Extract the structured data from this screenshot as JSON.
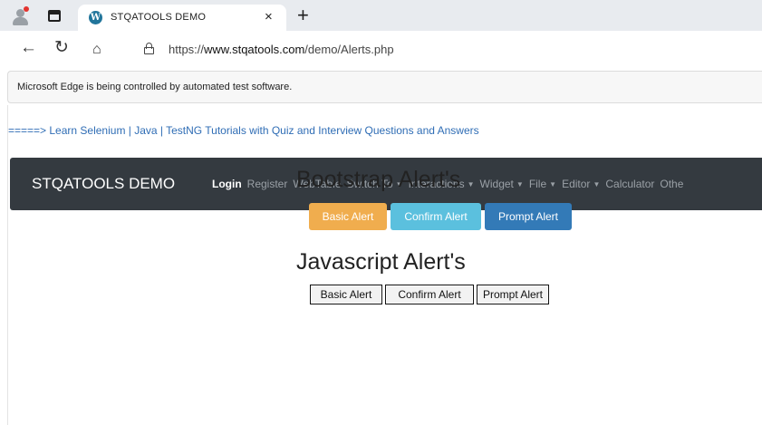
{
  "browser": {
    "tab_title": "STQATOOLS DEMO",
    "tab_close": "×",
    "new_tab": "+",
    "url_scheme": "https://",
    "url_host": "www.stqatools.com",
    "url_path": "/demo/Alerts.php",
    "infobar_text": "Microsoft Edge is being controlled by automated test software."
  },
  "page": {
    "promo_link": "=====> Learn Selenium | Java | TestNG Tutorials with Quiz and Interview Questions and Answers",
    "navbar": {
      "brand": "STQATOOLS DEMO",
      "items": [
        {
          "label": "Login",
          "active": true,
          "dropdown": false
        },
        {
          "label": "Register",
          "dropdown": false
        },
        {
          "label": "WebTable",
          "dropdown": false
        },
        {
          "label": "Switch To",
          "dropdown": true
        },
        {
          "label": "Interactions",
          "dropdown": true
        },
        {
          "label": "Widget",
          "dropdown": true
        },
        {
          "label": "File",
          "dropdown": true
        },
        {
          "label": "Editor",
          "dropdown": true
        },
        {
          "label": "Calculator",
          "dropdown": false
        },
        {
          "label": "Othe",
          "dropdown": false
        }
      ]
    },
    "bootstrap_section": {
      "heading": "Bootstrap Alert's",
      "basic": "Basic Alert",
      "confirm": "Confirm Alert",
      "prompt": "Prompt Alert"
    },
    "js_section": {
      "heading": "Javascript Alert's",
      "basic": "Basic Alert",
      "confirm": "Confirm Alert",
      "prompt": "Prompt Alert"
    }
  },
  "colors": {
    "navbar_bg": "#343a40",
    "warning": "#f0ad4e",
    "info": "#5bc0de",
    "primary": "#337ab7",
    "link": "#2f6db5"
  }
}
